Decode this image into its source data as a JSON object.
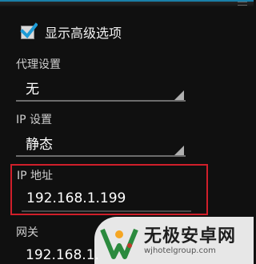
{
  "advanced": {
    "show_advanced_label": "显示高级选项",
    "checked": true
  },
  "proxy": {
    "label": "代理设置",
    "value": "无"
  },
  "ip_settings": {
    "label": "IP 设置",
    "value": "静态"
  },
  "ip_address": {
    "label": "IP 地址",
    "value": "192.168.1.199",
    "highlight_color": "#d01f2a"
  },
  "gateway": {
    "label": "网关",
    "value": "192.168.1."
  },
  "watermark": {
    "brand": "无极安卓网",
    "url": "wjhotelgroup.com",
    "colors": [
      "#2b8a3e",
      "#f5a623",
      "#c0392b"
    ]
  }
}
